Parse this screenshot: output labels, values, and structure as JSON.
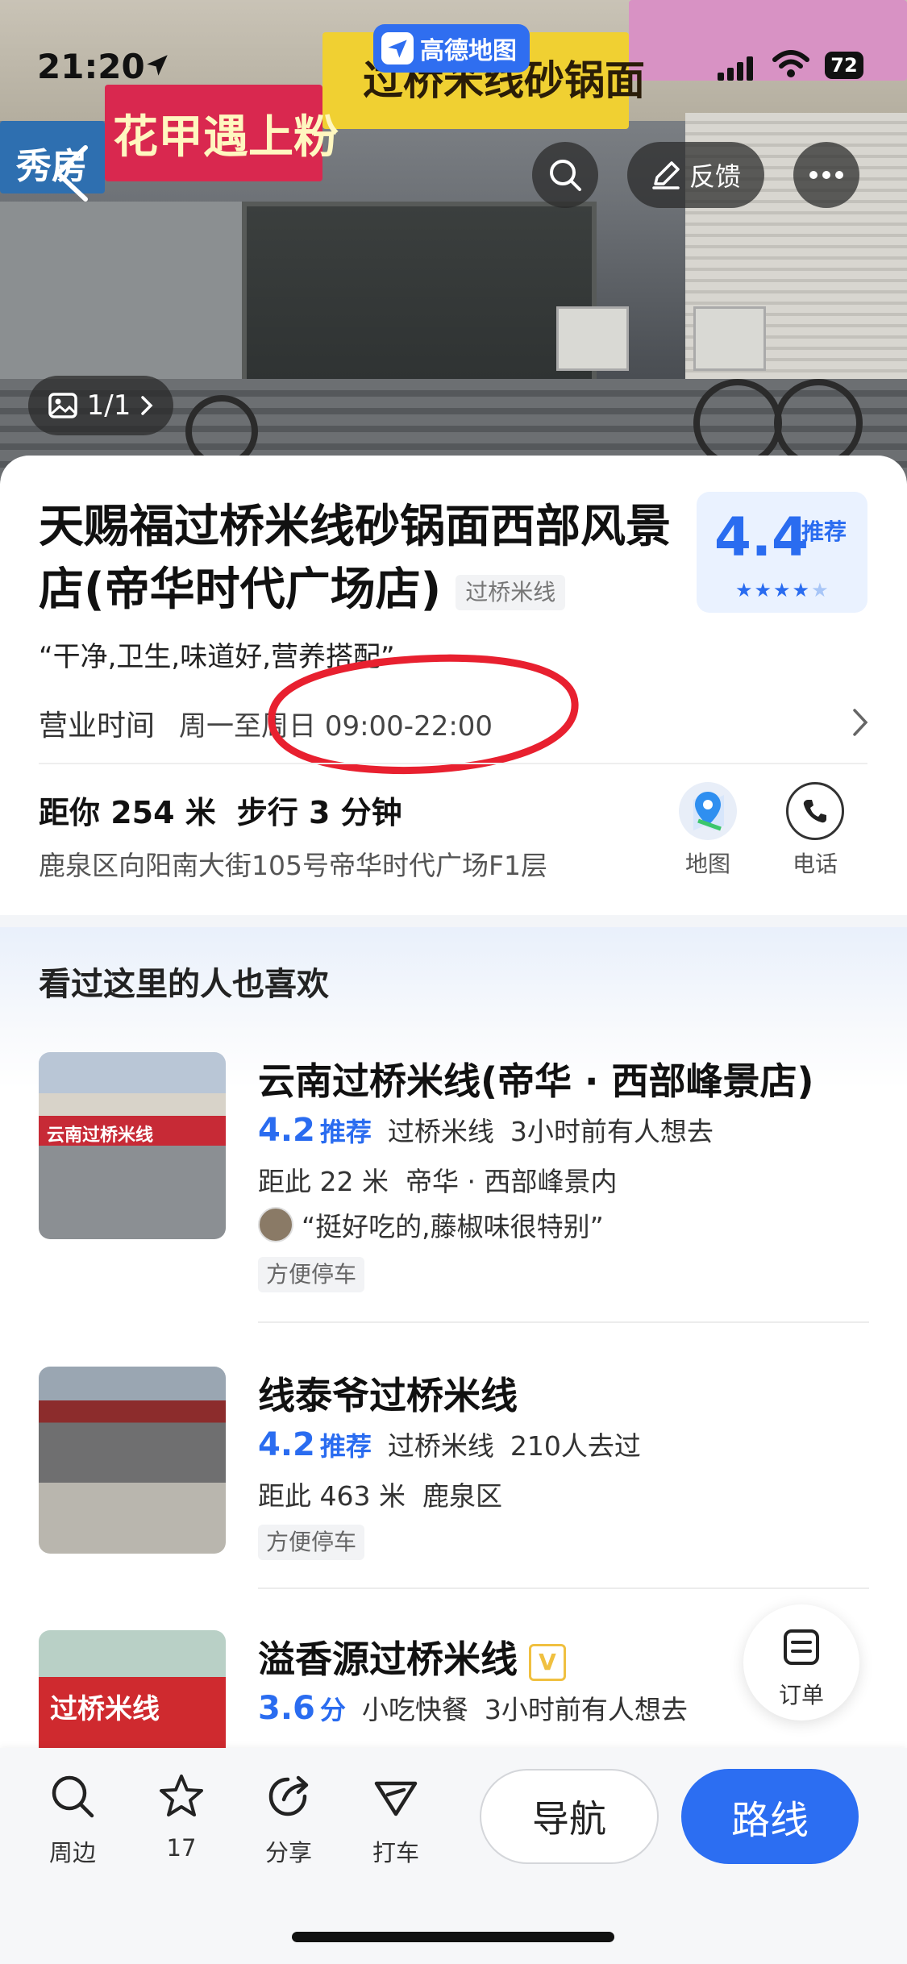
{
  "status_bar": {
    "time": "21:20",
    "battery": "72"
  },
  "app_badge": "高德地图",
  "hero": {
    "feedback_label": "反馈",
    "photo_count": "1/1",
    "signs": {
      "left": "秀房",
      "middle": "花甲遇上粉",
      "right": "过桥米线砂锅面"
    }
  },
  "poi": {
    "name": "天赐福过桥米线砂锅面西部风景店(帝华时代广场店)",
    "category": "过桥米线",
    "rating": "4.4",
    "rating_badge": "推荐",
    "rating_stars": 4,
    "quote": "“干净,卫生,味道好,营养搭配”",
    "hours_label": "营业时间",
    "hours_value": "周一至周日 09:00-22:00",
    "distance": "距你 254 米",
    "walk": "步行 3 分钟",
    "address": "鹿泉区向阳南大街105号帝华时代广场F1层",
    "map_label": "地图",
    "phone_label": "电话"
  },
  "recommend": {
    "title": "看过这里的人也喜欢",
    "items": [
      {
        "name": "云南过桥米线(帝华 · 西部峰景店)",
        "score": "4.2",
        "score_badge": "推荐",
        "category": "过桥米线",
        "activity": "3小时前有人想去",
        "distance": "距此 22 米",
        "area": "帝华 · 西部峰景内",
        "review": "“挺好吃的,藤椒味很特别”",
        "tag": "方便停车",
        "thumb_text": "云南过桥米线"
      },
      {
        "name": "线泰爷过桥米线",
        "score": "4.2",
        "score_badge": "推荐",
        "category": "过桥米线",
        "activity": "210人去过",
        "distance": "距此 463 米",
        "area": "鹿泉区",
        "tag": "方便停车"
      },
      {
        "name": "溢香源过桥米线",
        "vip": "V",
        "score": "3.6",
        "score_badge": "分",
        "category": "小吃快餐",
        "activity": "3小时前有人想去",
        "thumb_text": "过桥米线"
      }
    ]
  },
  "order_label": "订单",
  "bottom_bar": {
    "nearby": "周边",
    "favorites": "17",
    "share": "分享",
    "taxi": "打车",
    "navigate": "导航",
    "route": "路线"
  },
  "colors": {
    "accent": "#2c6ef2",
    "annotation": "#e8202f"
  }
}
